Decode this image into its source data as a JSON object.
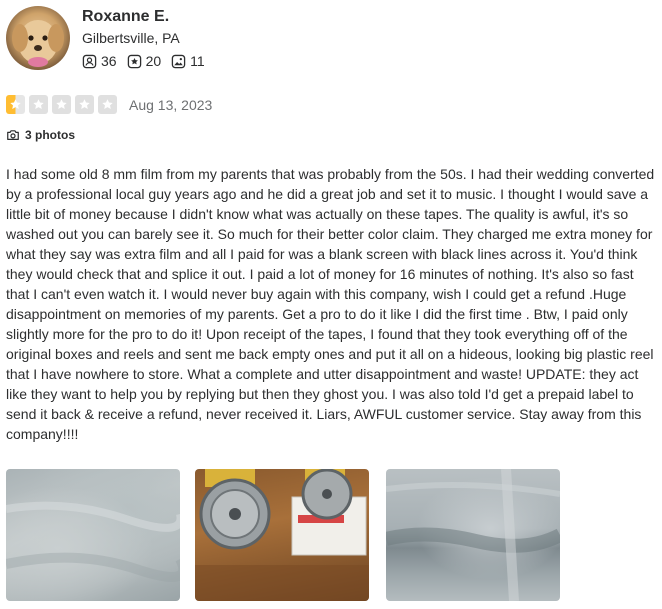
{
  "user": {
    "name": "Roxanne E.",
    "location": "Gilbertsville, PA",
    "stats": {
      "friends": "36",
      "reviews": "20",
      "photos": "11"
    }
  },
  "review": {
    "rating": 1,
    "rating_max": 5,
    "date": "Aug 13, 2023",
    "photos_label": "3 photos",
    "text": "I had some old 8 mm film from my parents that was probably from the 50s. I had their wedding converted by a professional local guy years ago and he did a great job and set it to music. I thought I would save a little bit of money because I didn't know what was actually on these tapes. The quality is awful, it's so washed out you can barely see it. So much for their better color claim. They charged me extra money for what they say was extra film and all I paid for was a blank screen with black lines across it. You'd think they would check that and splice it out. I paid a lot of money for 16 minutes of nothing. It's also so fast that I can't even watch it. I would never buy again with this company, wish I could get a refund .Huge disappointment on memories of my parents. Get a pro to do it like I did the first time . Btw, I paid only slightly more for the pro to do it! Upon receipt of the tapes, I found that they took everything off of the original boxes and reels and sent me back empty ones and put it all on a hideous, looking big plastic reel that I have nowhere to store. What a complete and utter disappointment and waste! UPDATE: they act like they want to help you by replying but then they ghost you. I was also told I'd get a prepaid label to send it back & receive a refund, never received it. Liars, AWFUL customer service. Stay away from this company!!!!"
  },
  "colors": {
    "star_filled": "#ffbd32",
    "star_empty": "#e0e0e0",
    "text": "#2d2e2f",
    "muted": "#6e7072"
  },
  "icons": {
    "friends": "friends-icon",
    "reviews": "review-star-icon",
    "photos": "photo-icon",
    "camera": "camera-icon"
  }
}
